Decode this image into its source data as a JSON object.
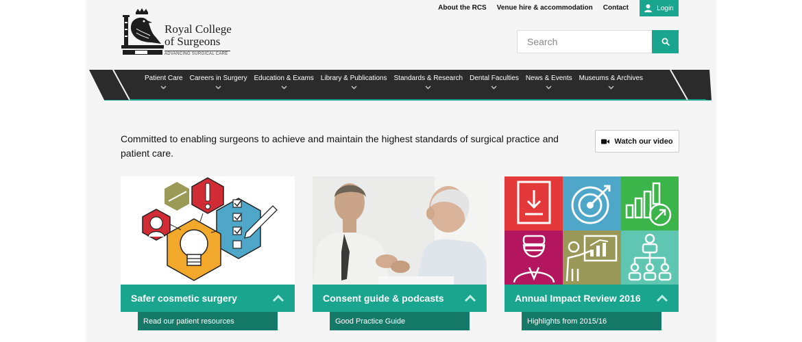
{
  "colors": {
    "teal": "#1aa68e",
    "teal_dark": "#147a67",
    "nav_bg": "#2b2b2b"
  },
  "top_links": [
    "About the RCS",
    "Venue hire & accommodation",
    "Contact"
  ],
  "login": {
    "label": "Login",
    "icon": "user-icon"
  },
  "logo": {
    "line1": "Royal College",
    "line2": "of Surgeons",
    "tagline": "ADVANCING SURGICAL CARE"
  },
  "search": {
    "placeholder": "Search",
    "value": "",
    "icon": "search-icon"
  },
  "nav": {
    "items": [
      "Patient Care",
      "Careers in Surgery",
      "Education & Exams",
      "Library & Publications",
      "Standards & Research",
      "Dental Faculties",
      "News & Events",
      "Museums & Archives"
    ]
  },
  "intro": {
    "text": "Committed to enabling surgeons to achieve and maintain the highest standards of surgical practice and patient care.",
    "video_button": "Watch our video"
  },
  "cards": [
    {
      "title": "Safer cosmetic surgery",
      "link": "Read our patient resources",
      "image": "cosmetic-surgery-illustration"
    },
    {
      "title": "Consent guide & podcasts",
      "link": "Good Practice Guide",
      "image": "doctor-patient-photo"
    },
    {
      "title": "Annual Impact Review 2016",
      "link": "Highlights from 2015/16",
      "image": "impact-review-tiles"
    }
  ]
}
